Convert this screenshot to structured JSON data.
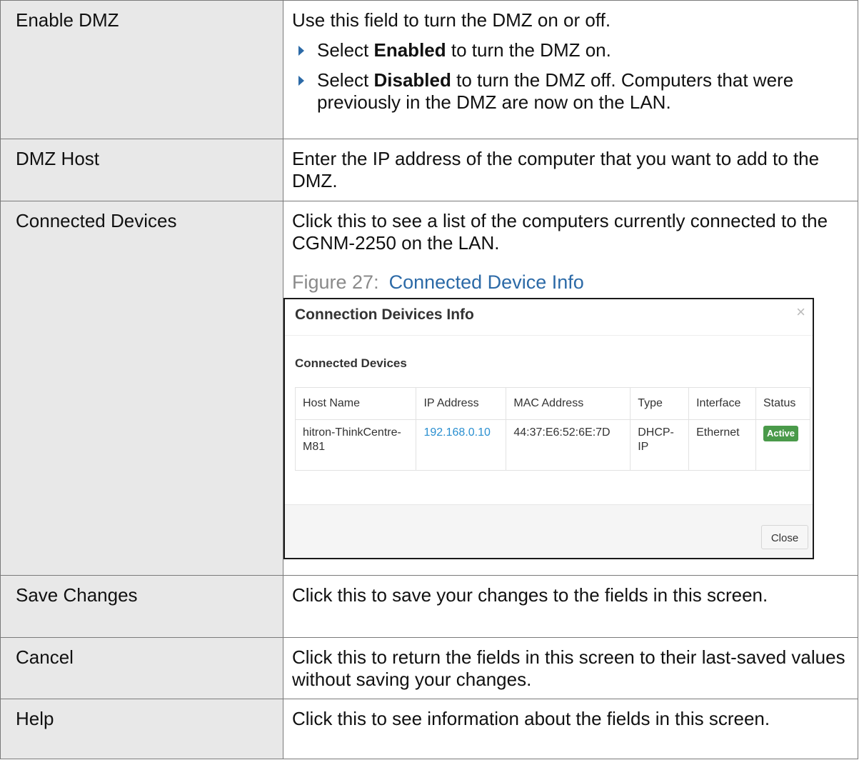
{
  "rows": [
    {
      "label": "Enable DMZ",
      "desc": "Use this field to turn the DMZ on or off."
    },
    {
      "label": "DMZ Host",
      "desc": "Enter the IP address of the computer that you want to add to the DMZ."
    },
    {
      "label": "Connected Devices",
      "desc": "Click this to see a list of the computers currently connected to the CGNM-2250 on the LAN."
    },
    {
      "label": "Save Changes",
      "desc": "Click this to save your changes to the fields in this screen."
    },
    {
      "label": "Cancel",
      "desc": "Click this to return the fields in this screen to their last-saved values without saving your changes."
    },
    {
      "label": "Help",
      "desc": "Click this to see information about the fields in this screen."
    }
  ],
  "bullets": {
    "enabled": {
      "pre": "Select ",
      "bold": "Enabled",
      "post": " to turn the DMZ on."
    },
    "disabled": {
      "pre": "Select ",
      "bold": "Disabled",
      "post": " to turn the DMZ off. Computers that were previously in the DMZ are now on the LAN."
    }
  },
  "figure": {
    "number": "Figure 27:",
    "title": "Connected Device Info"
  },
  "dialog": {
    "title": "Connection Deivices Info",
    "close_icon": "×",
    "subtitle": "Connected Devices",
    "columns": [
      "Host Name",
      "IP Address",
      "MAC Address",
      "Type",
      "Interface",
      "Status"
    ],
    "device": {
      "host": "hitron-ThinkCentre-M81",
      "ip": "192.168.0.10",
      "mac": "44:37:E6:52:6E:7D",
      "type": "DHCP-IP",
      "interface": "Ethernet",
      "status": "Active"
    },
    "close_button": "Close"
  }
}
